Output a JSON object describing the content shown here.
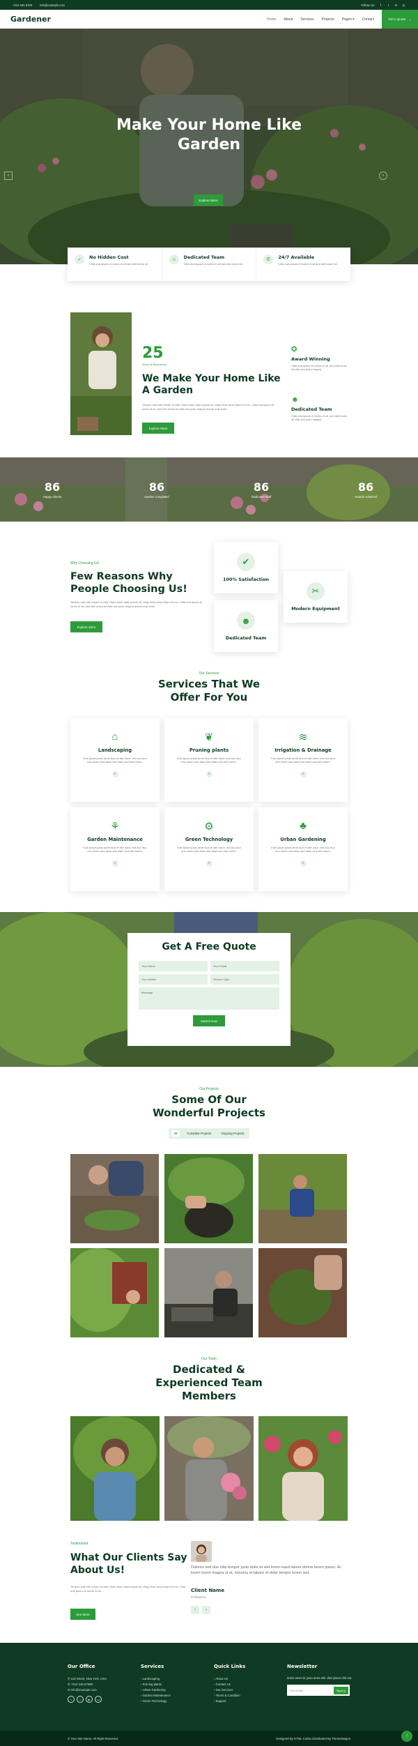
{
  "topbar": {
    "phone": "+012 345 6780",
    "email": "info@example.com",
    "follow": "Follow Us:"
  },
  "nav": {
    "logo": "Gardener",
    "items": [
      "Home",
      "About",
      "Services",
      "Projects",
      "Pages",
      "Contact"
    ],
    "cta": "Get A Quote"
  },
  "hero": {
    "title_line1": "Make Your Home Like",
    "title_line2": "Garden",
    "button": "Explore More"
  },
  "features": [
    {
      "title": "No Hidden Cost",
      "text": "Clita erat ipsum et lorem et sit sed stet lorem sit"
    },
    {
      "title": "Dedicated Team",
      "text": "Clita erat ipsum et lorem et sit sed stet lorem sit"
    },
    {
      "title": "24/7 Available",
      "text": "Clita erat ipsum et lorem et sit sed stet lorem sit"
    }
  ],
  "about": {
    "years": "25",
    "years_label": "Years of Experience",
    "title": "We Make Your Home Like A Garden",
    "text": "Tempor erat elitr rebum at clita. Diam dolor diam ipsum sit. Aliqu diam amet diam et eos. Clita erat ipsum et lorem et sit, sed stet lorem sit clita duo justo magna dolore erat amet",
    "button": "Explore More",
    "side": [
      {
        "title": "Award Winning",
        "text": "Clita erat ipsum et lorem et sit, sed stet lorem sit clita duo justo magna"
      },
      {
        "title": "Dedicated Team",
        "text": "Clita erat ipsum et lorem et sit, sed stet lorem sit clita duo justo magna"
      }
    ]
  },
  "counters": [
    {
      "num": "86",
      "label": "Happy Clients"
    },
    {
      "num": "86",
      "label": "Garden Complated"
    },
    {
      "num": "86",
      "label": "Dedicated Staff"
    },
    {
      "num": "86",
      "label": "Awards Achieved"
    }
  ],
  "why": {
    "tag": "Why Choosing Us!",
    "title": "Few Reasons Why People Choosing Us!",
    "text": "Tempor erat elitr rebum at clita. Diam dolor diam ipsum sit. Aliqu diam amet diam et eos. Clita erat ipsum et lorem et sit, sed stet lorem sit clita duo justo magna dolore erat amet",
    "button": "Explore More",
    "boxes": [
      "100% Satisfaction",
      "Dedicated Team",
      "Modern Equipment"
    ]
  },
  "services": {
    "tag": "Our Services",
    "title_line1": "Services That We",
    "title_line2": "Offer For You",
    "items": [
      {
        "title": "Landscaping",
        "text": "Erat ipsum justo amet duo et elitr dolor, est duo duo eos lorem sed diam stet diam sed stet lorem."
      },
      {
        "title": "Pruning plants",
        "text": "Erat ipsum justo amet duo et elitr dolor, est duo duo eos lorem sed diam stet diam sed stet lorem."
      },
      {
        "title": "Irrigation & Drainage",
        "text": "Erat ipsum justo amet duo et elitr dolor, est duo duo eos lorem sed diam stet diam sed stet lorem."
      },
      {
        "title": "Garden Maintenance",
        "text": "Erat ipsum justo amet duo et elitr dolor, est duo duo eos lorem sed diam stet diam sed stet lorem."
      },
      {
        "title": "Green Technology",
        "text": "Erat ipsum justo amet duo et elitr dolor, est duo duo eos lorem sed diam stet diam sed stet lorem."
      },
      {
        "title": "Urban Gardening",
        "text": "Erat ipsum justo amet duo et elitr dolor, est duo duo eos lorem sed diam stet diam sed stet lorem."
      }
    ]
  },
  "quote": {
    "title": "Get A Free Quote",
    "fields": {
      "name": "Your Name",
      "email": "Your Email",
      "mobile": "Your Mobile",
      "service": "Service Type",
      "message": "Message"
    },
    "button": "Submit Now"
  },
  "projects": {
    "tag": "Our Projects",
    "title_line1": "Some Of Our",
    "title_line2": "Wonderful Projects",
    "filters": [
      "All",
      "Complete Projects",
      "Ongoing Projects"
    ]
  },
  "team": {
    "tag": "Our Team",
    "title_line1": "Dedicated &",
    "title_line2": "Experienced Team",
    "title_line3": "Members"
  },
  "testimonial": {
    "tag": "Testimonial",
    "title": "What Our Clients Say About Us!",
    "text": "Tempor erat elitr rebum at clita. Diam dolor diam ipsum sit. Aliqu diam amet diam et eos. Clita erat ipsum et lorem et sit.",
    "button": "See More",
    "quote": "Dolores sed duo clita tempor justo dolor et stet lorem kasd labore dolore lorem ipsum. At lorem lorem magna ut et, nonumy et labore et dolor tempor lorem sed.",
    "client": "Client Name",
    "profession": "Profession"
  },
  "footer": {
    "office": {
      "title": "Our Office",
      "address": "123 Street, New York, USA",
      "phone": "+012 345 67890",
      "email": "info@example.com"
    },
    "services": {
      "title": "Services",
      "items": [
        "Landscaping",
        "Pruning plants",
        "Urban Gardening",
        "Garden Maintenance",
        "Green Technology"
      ]
    },
    "links": {
      "title": "Quick Links",
      "items": [
        "About Us",
        "Contact Us",
        "Our Services",
        "Terms & Condition",
        "Support"
      ]
    },
    "newsletter": {
      "title": "Newsletter",
      "text": "Dolor amet sit justo amet elitr clita ipsum elitr est.",
      "placeholder": "Your email",
      "button": "SignUp"
    }
  },
  "copyright": {
    "left": "© Your Site Name, All Right Reserved.",
    "right": "Designed By HTML Codex Distributed By ThemeWagon"
  },
  "colors": {
    "primary": "#2d9b3a",
    "dark": "#0e3b22",
    "light": "#e3f2e5"
  }
}
